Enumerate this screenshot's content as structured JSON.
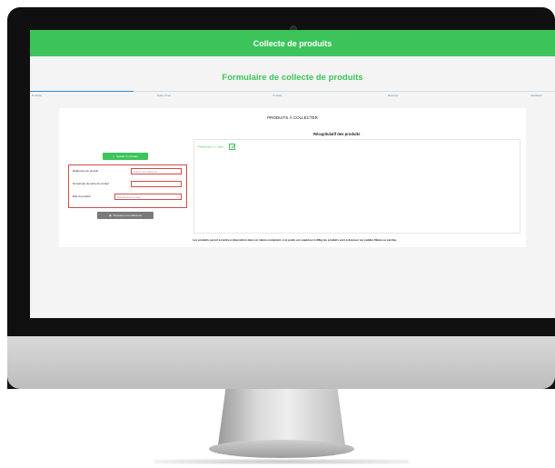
{
  "header": {
    "title": "Collecte de produits"
  },
  "form": {
    "title": "Formulaire de collecte de produits"
  },
  "stepper": {
    "steps": [
      "Produits",
      "Date et lieu",
      "Contact",
      "Résumé",
      "Validation"
    ],
    "active_index": 0
  },
  "card": {
    "heading": "PRODUITS À COLLECTER",
    "recap_title": "Récapitulatif des produits",
    "add_button_label": "Ajouter un produit",
    "propose_button_label": "Proposer une référence",
    "fields": {
      "reference_label": "Référence du produit",
      "reference_placeholder": "Entrez une référence...",
      "serial_label": "Numéro(s) de série du produit",
      "state_label": "État du produit",
      "state_value": "Sélectionnez un état..."
    },
    "recap_line": "• Référence x 1 - État",
    "note": "Les produits seront à mettre à disposition dans un même contenant, si le poids est supérieur à 30kg les produits sont à déposer sur palette filmée ou cerclée."
  },
  "colors": {
    "accent": "#3cc45a",
    "error_border": "#d24a4a",
    "step_active": "#2f8bd4"
  }
}
